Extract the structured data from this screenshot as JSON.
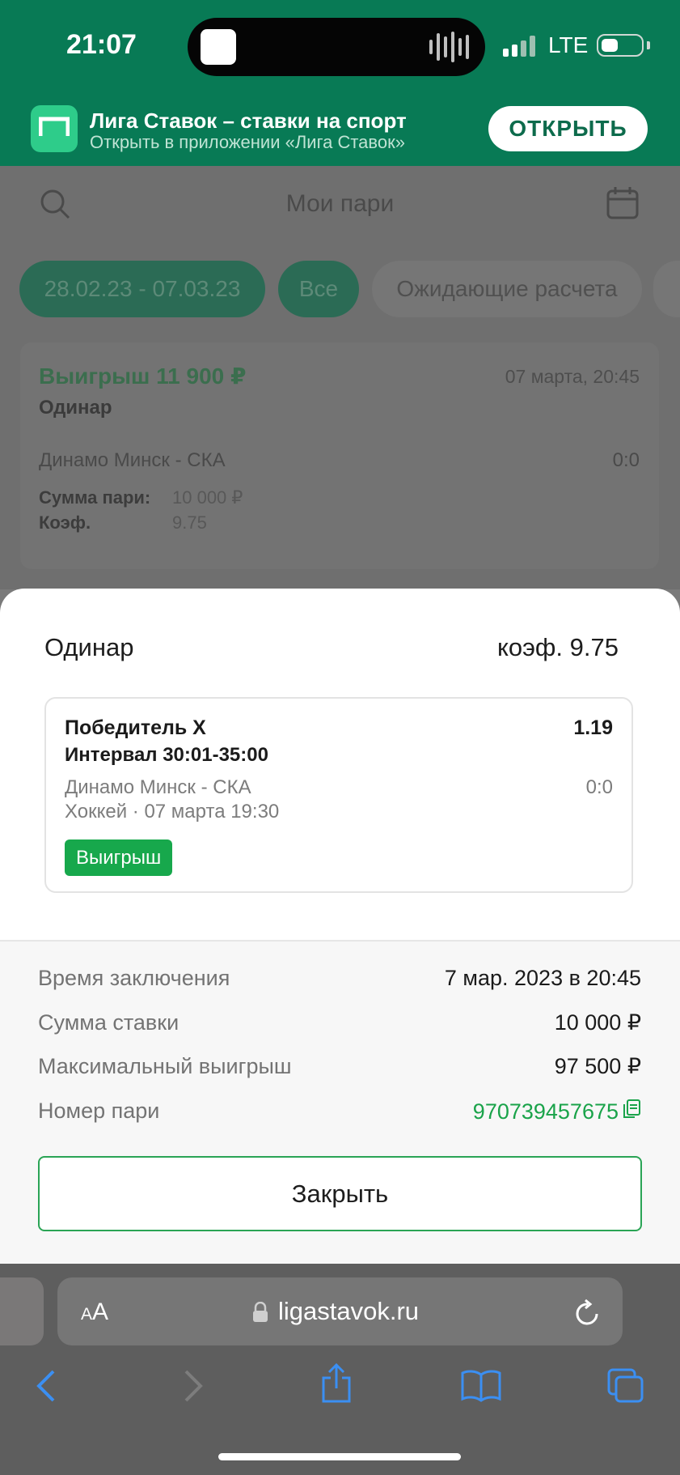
{
  "status_bar": {
    "time": "21:07",
    "network": "LTE"
  },
  "app_banner": {
    "title": "Лига Ставок – ставки на спорт",
    "subtitle": "Открыть в приложении «Лига Ставок»",
    "open_label": "ОТКРЫТЬ"
  },
  "header": {
    "title": "Мои пари"
  },
  "filters": [
    {
      "label": "28.02.23 - 07.03.23",
      "active": true
    },
    {
      "label": "Все",
      "active": true
    },
    {
      "label": "Ожидающие расчета",
      "active": false
    }
  ],
  "bet_card": {
    "win_text": "Выигрыш 11 900 ₽",
    "datetime": "07 марта, 20:45",
    "type": "Одинар",
    "match": "Динамо Минск - СКА",
    "score": "0:0",
    "stake_label": "Сумма пари:",
    "stake_value": "10 000 ₽",
    "coef_label": "Коэф.",
    "coef_value": "9.75"
  },
  "sheet": {
    "bet_type": "Одинар",
    "coef": "коэф. 9.75",
    "event": {
      "outcome": "Победитель  X",
      "odds": "1.19",
      "interval": "Интервал 30:01-35:00",
      "match": "Динамо Минск - СКА",
      "score": "0:0",
      "sport_date": "Хоккей · 07 марта 19:30",
      "status": "Выигрыш"
    },
    "details": [
      {
        "label": "Время заключения",
        "value": "7 мар. 2023 в 20:45"
      },
      {
        "label": "Сумма ставки",
        "value": "10 000 ₽"
      },
      {
        "label": "Максимальный выигрыш",
        "value": "97 500 ₽"
      }
    ],
    "bet_number_label": "Номер пари",
    "bet_number": "970739457675",
    "close_label": "Закрыть"
  },
  "browser": {
    "aa_small": "A",
    "aa_large": "A",
    "url": "ligastavok.ru"
  },
  "colors": {
    "brand_green": "#087a55",
    "accent_green": "#1aa34a",
    "status_win": "#17a84c"
  }
}
